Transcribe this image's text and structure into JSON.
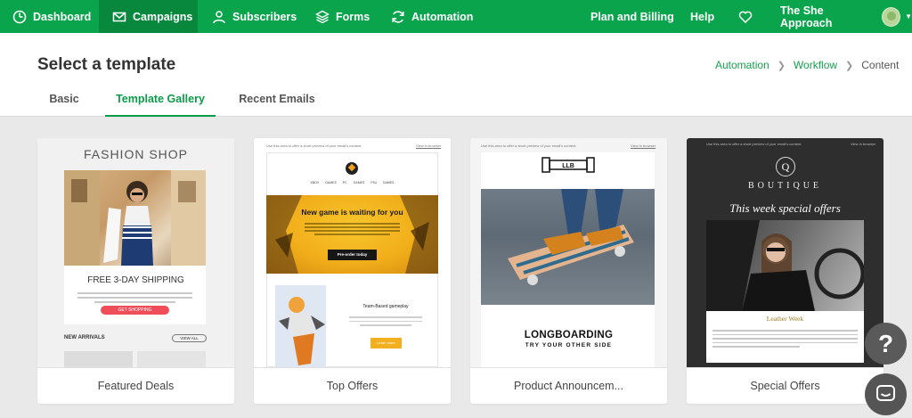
{
  "nav": {
    "items": [
      {
        "label": "Dashboard",
        "icon": "dashboard-icon"
      },
      {
        "label": "Campaigns",
        "icon": "envelope-icon"
      },
      {
        "label": "Subscribers",
        "icon": "person-icon"
      },
      {
        "label": "Forms",
        "icon": "layers-icon"
      },
      {
        "label": "Automation",
        "icon": "refresh-icon"
      }
    ],
    "active": "Campaigns",
    "plan_billing": "Plan and Billing",
    "help": "Help",
    "heart_icon": "heart-icon",
    "account_name": "The She Approach",
    "colors": {
      "bar": "#09a44b",
      "active": "#07883d"
    }
  },
  "header": {
    "title": "Select a template",
    "breadcrumb": {
      "automation": "Automation",
      "workflow": "Workflow",
      "current": "Content"
    },
    "tabs": [
      "Basic",
      "Template Gallery",
      "Recent Emails"
    ],
    "active_tab": "Template Gallery"
  },
  "templates": [
    {
      "name": "Featured Deals",
      "preview": {
        "shop": "FASHION SHOP",
        "shipping": "FREE 3-DAY SHIPPING",
        "cta": "GET SHOPPING",
        "arrivals": "NEW ARRIVALS",
        "view_all": "VIEW ALL"
      }
    },
    {
      "name": "Top Offers",
      "preview": {
        "preheader": "Use this area to offer a short preview of your email's content.",
        "browser": "View in browser",
        "games_nav": "XBOX GAMES PC GAMES PS4 GAMES",
        "headline": "New game is waiting for you",
        "cta": "Pre-order today",
        "feature": "Team-Based gameplay",
        "learn": "Learn more"
      }
    },
    {
      "name": "Product Announcem...",
      "preview": {
        "preheader": "Use this area to offer a short preview of your email's content.",
        "browser": "View in browser",
        "logo": "LLB",
        "headline": "LONGBOARDING",
        "subline": "TRY YOUR OTHER SIDE"
      }
    },
    {
      "name": "Special Offers",
      "preview": {
        "preheader": "Use this area to offer a short preview of your email's content.",
        "browser": "View in browser",
        "emblem": "Q",
        "brand": "BOUTIQUE",
        "headline": "This week special offers",
        "feature": "Leather Week"
      }
    }
  ],
  "floating": {
    "help": "?",
    "chat_icon": "chat-icon"
  }
}
